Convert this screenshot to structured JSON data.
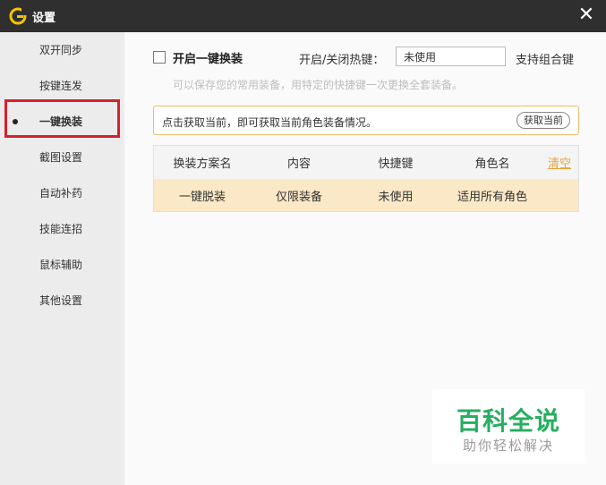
{
  "window": {
    "title": "设置",
    "close_glyph": "✕"
  },
  "sidebar": {
    "items": [
      {
        "label": "双开同步"
      },
      {
        "label": "按键连发"
      },
      {
        "label": "一键换装",
        "active": true
      },
      {
        "label": "截图设置"
      },
      {
        "label": "自动补药"
      },
      {
        "label": "技能连招"
      },
      {
        "label": "鼠标辅助"
      },
      {
        "label": "其他设置"
      }
    ]
  },
  "feature": {
    "title": "开启一键换装",
    "hotkey_label": "开启/关闭热键：",
    "hotkey_value": "未使用",
    "combo_label": "支持组合键",
    "description": "可以保存您的常用装备，用特定的快捷键一次更换全套装备。"
  },
  "notice": {
    "text": "点击获取当前，即可获取当前角色装备情况。",
    "button": "获取当前"
  },
  "table": {
    "headers": [
      "换装方案名",
      "内容",
      "快捷键",
      "角色名"
    ],
    "clear_label": "清空",
    "rows": [
      [
        "一键脱装",
        "仅限装备",
        "未使用",
        "适用所有角色"
      ]
    ]
  },
  "watermark": {
    "main": "百科全说",
    "sub": "助你轻松解决"
  },
  "colors": {
    "accent": "#e6a33a",
    "highlight": "#d9202a",
    "row_bg": "#fbe8c6",
    "watermark": "#27ae60"
  },
  "icons": {
    "app": "app-logo-icon",
    "close": "close-icon"
  }
}
